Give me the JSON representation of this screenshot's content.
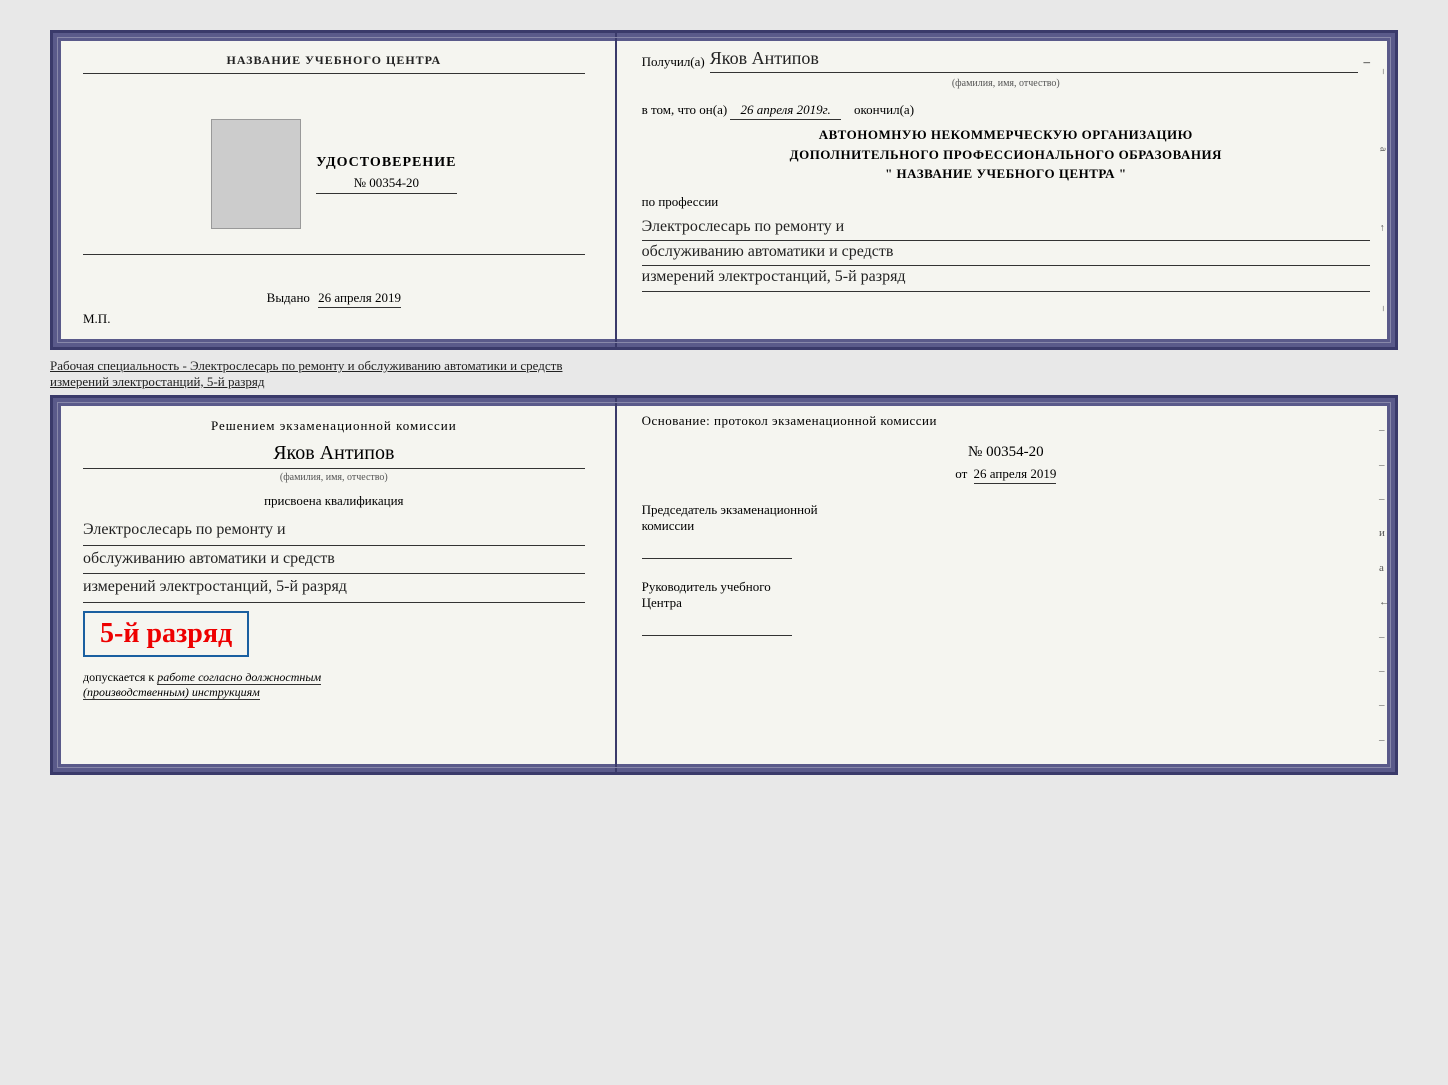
{
  "page": {
    "bg_color": "#e8e8e8"
  },
  "top_cert": {
    "left": {
      "org_name": "НАЗВАНИЕ УЧЕБНОГО ЦЕНТРА",
      "udostoverenie_title": "УДОСТОВЕРЕНИЕ",
      "udostoverenie_number": "№ 00354-20",
      "vydano_label": "Выдано",
      "vydano_date": "26 апреля 2019",
      "mp_label": "М.П."
    },
    "right": {
      "received_label": "Получил(а)",
      "recipient_name": "Яков Антипов",
      "fio_label": "(фамилия, имя, отчество)",
      "vtom_label": "в том, что он(а)",
      "completed_date": "26 апреля 2019г.",
      "completed_label": "окончил(а)",
      "org_line1": "АВТОНОМНУЮ НЕКОММЕРЧЕСКУЮ ОРГАНИЗАЦИЮ",
      "org_line2": "ДОПОЛНИТЕЛЬНОГО ПРОФЕССИОНАЛЬНОГО ОБРАЗОВАНИЯ",
      "org_line3": "\"   НАЗВАНИЕ УЧЕБНОГО ЦЕНТРА   \"",
      "po_professii_label": "по профессии",
      "profession_line1": "Электрослесарь по ремонту и",
      "profession_line2": "обслуживанию автоматики и средств",
      "profession_line3": "измерений электростанций, 5-й разряд",
      "side_marks": [
        "–",
        "а",
        "←",
        "–"
      ]
    }
  },
  "between_text": "Рабочая специальность - Электрослесарь по ремонту и обслуживанию автоматики и средств\nизмерений электростанций, 5-й разряд",
  "bottom_cert": {
    "left": {
      "resheniem_label": "Решением экзаменационной комиссии",
      "name": "Яков Антипов",
      "fio_label": "(фамилия, имя, отчество)",
      "prisvoena_label": "присвоена квалификация",
      "qual_line1": "Электрослесарь по ремонту и",
      "qual_line2": "обслуживанию автоматики и средств",
      "qual_line3": "измерений электростанций, 5-й разряд",
      "rank_text": "5-й разряд",
      "dopuskaetsya_label": "допускается к",
      "dopuskaetsya_text": "работе согласно должностным",
      "dopuskaetsya_text2": "(производственным) инструкциям"
    },
    "right": {
      "osnovanie_label": "Основание: протокол экзаменационной комиссии",
      "number_label": "№ 00354-20",
      "ot_label": "от",
      "date": "26 апреля 2019",
      "predsedatel_label": "Председатель экзаменационной",
      "predsedatel_label2": "комиссии",
      "rukovoditel_label": "Руководитель учебного",
      "rukovoditel_label2": "Центра",
      "side_marks": [
        "–",
        "–",
        "–",
        "и",
        "а",
        "←",
        "–",
        "–",
        "–",
        "–"
      ]
    }
  }
}
